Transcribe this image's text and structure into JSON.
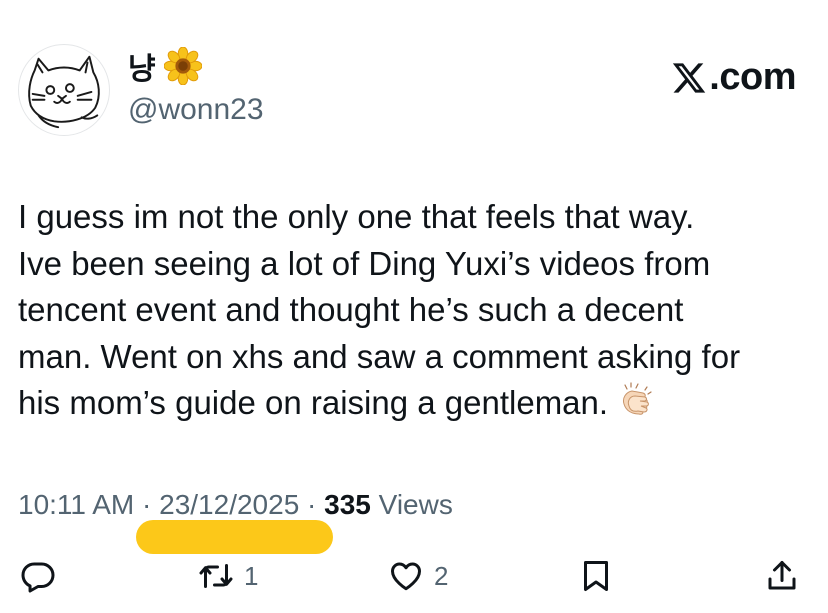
{
  "user": {
    "display_name": "냥",
    "display_emoji": "sunflower-emoji",
    "handle": "@wonn23",
    "avatar": "cat-sketch-avatar"
  },
  "brand": {
    "text": ".com",
    "logo": "x-logo-icon"
  },
  "tweet": {
    "text": "I guess im not the only one that feels that way.\nIve been seeing a lot of Ding Yuxi’s videos from\ntencent event and thought he’s such a decent\nman. Went on xhs and saw a comment asking for\nhis mom’s guide on raising a gentleman.",
    "trailing_emoji": "clapping-hands-emoji"
  },
  "meta": {
    "time": "10:11 AM",
    "separator": "·",
    "date": "23/12/2025",
    "views_count": "335",
    "views_label": "Views",
    "highlight_color": "#fcc50d"
  },
  "actions": {
    "reply_icon": "reply-icon",
    "retweet_icon": "retweet-icon",
    "retweet_count": "1",
    "like_icon": "heart-icon",
    "like_count": "2",
    "bookmark_icon": "bookmark-icon",
    "share_icon": "share-icon"
  },
  "colors": {
    "text_primary": "#0f1419",
    "text_secondary": "#536471"
  }
}
